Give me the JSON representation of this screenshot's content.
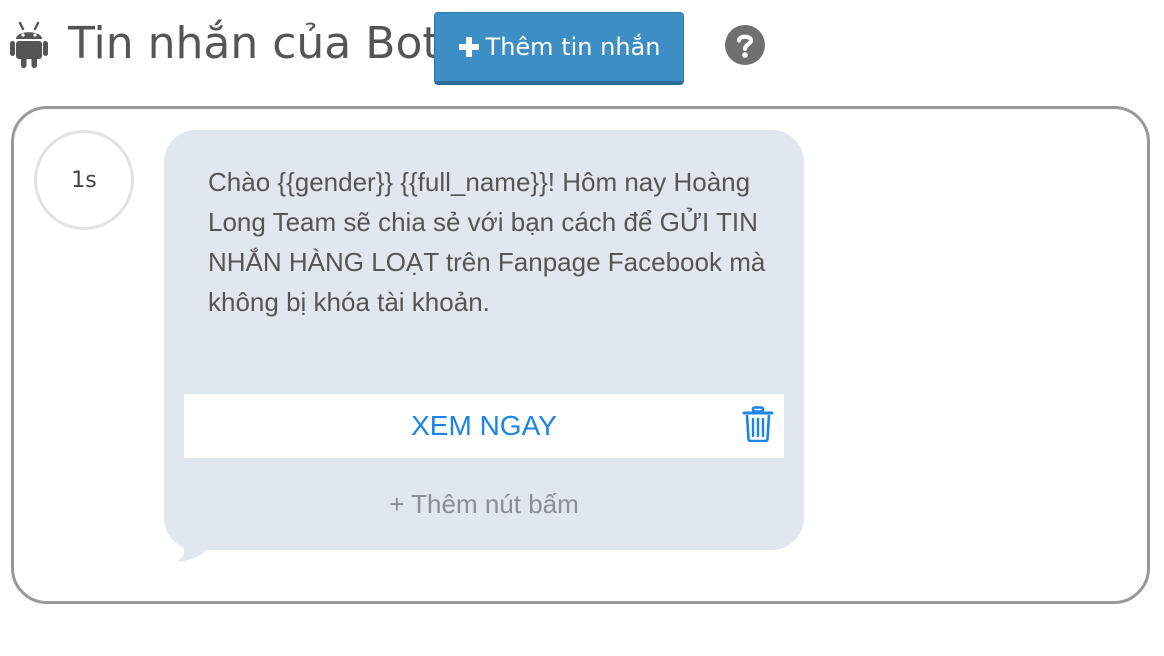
{
  "header": {
    "icon": "android-icon",
    "title": "Tin nhắn của Bot",
    "add_button": {
      "icon": "plus-icon",
      "label": "Thêm tin nhắn",
      "color": "#3d8ec4"
    },
    "help_icon": "question-circle-icon"
  },
  "message": {
    "delay": "1s",
    "text": "Chào {{gender}} {{full_name}}! Hôm nay Hoàng Long Team sẽ chia sẻ với bạn cách để GỬI TIN NHẮN HÀNG LOẠT trên Fanpage Facebook mà không bị khóa tài khoản.",
    "bubble_color": "#e1e7ee",
    "buttons": [
      {
        "label": "XEM NGAY",
        "color": "#1a85e6",
        "delete_icon": "trash-icon"
      }
    ],
    "add_button_label": "+ Thêm nút bấm"
  }
}
